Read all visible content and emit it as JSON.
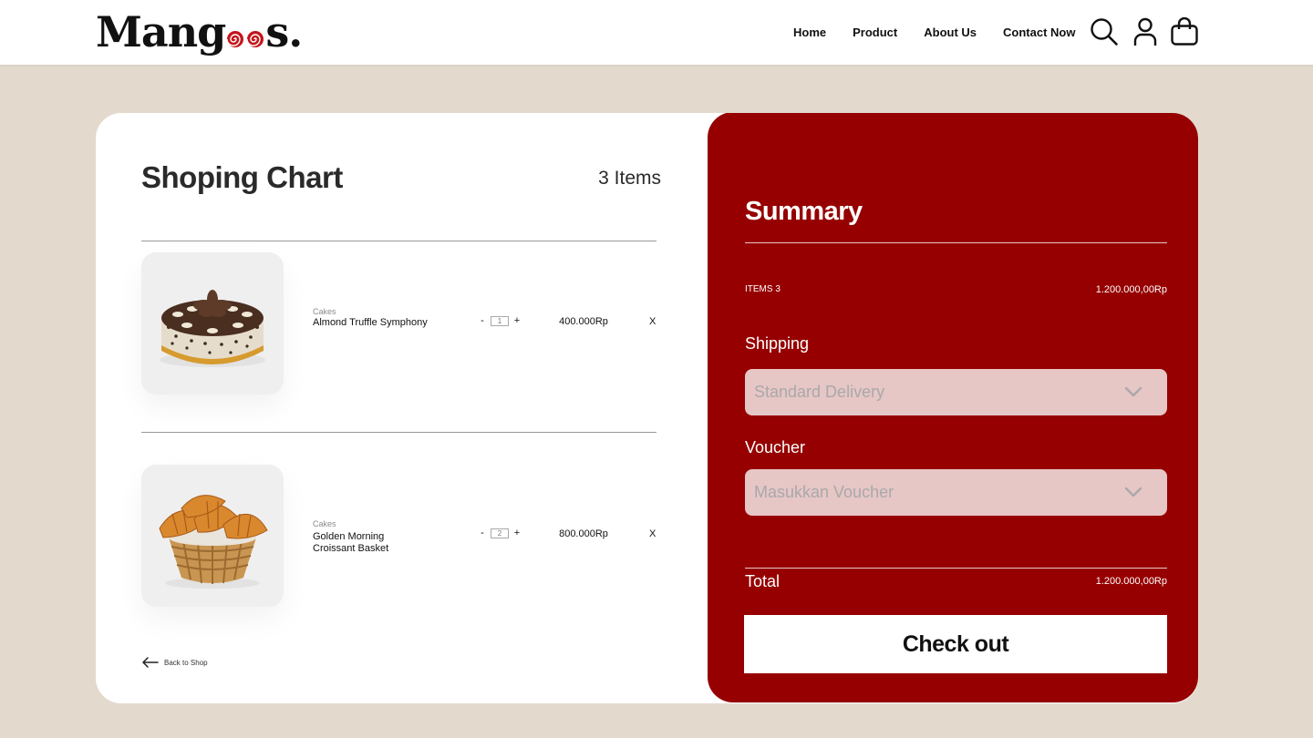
{
  "header": {
    "logo_prefix": "Mang",
    "logo_suffix": "s.",
    "nav": [
      "Home",
      "Product",
      "About Us",
      "Contact Now"
    ],
    "icons": [
      "search-icon",
      "user-icon",
      "shopping-bag-icon"
    ]
  },
  "cart": {
    "title": "Shoping Chart",
    "count": "3 Items",
    "items": [
      {
        "category": "Cakes",
        "name": "Almond Truffle Symphony",
        "quantity": "1",
        "price": "400.000Rp",
        "remove": "X"
      },
      {
        "category": "Cakes",
        "name": "Golden Morning Croissant Basket",
        "quantity": "2",
        "price": "800.000Rp",
        "remove": "X"
      }
    ],
    "qty_minus": "-",
    "qty_plus": "+",
    "back_label": "Back to Shop"
  },
  "summary": {
    "title": "Summary",
    "items_label": "ITEMS 3",
    "items_value": "1.200.000,00Rp",
    "shipping_label": "Shipping",
    "shipping_value": "Standard Delivery",
    "voucher_label": "Voucher",
    "voucher_placeholder": "Masukkan Voucher",
    "total_label": "Total",
    "total_value": "1.200.000,00Rp",
    "checkout_label": "Check out"
  },
  "colors": {
    "background": "#e3dacd",
    "accent": "#960000",
    "select_bg": "#e7c6c6",
    "swirl": "#c2161b"
  }
}
